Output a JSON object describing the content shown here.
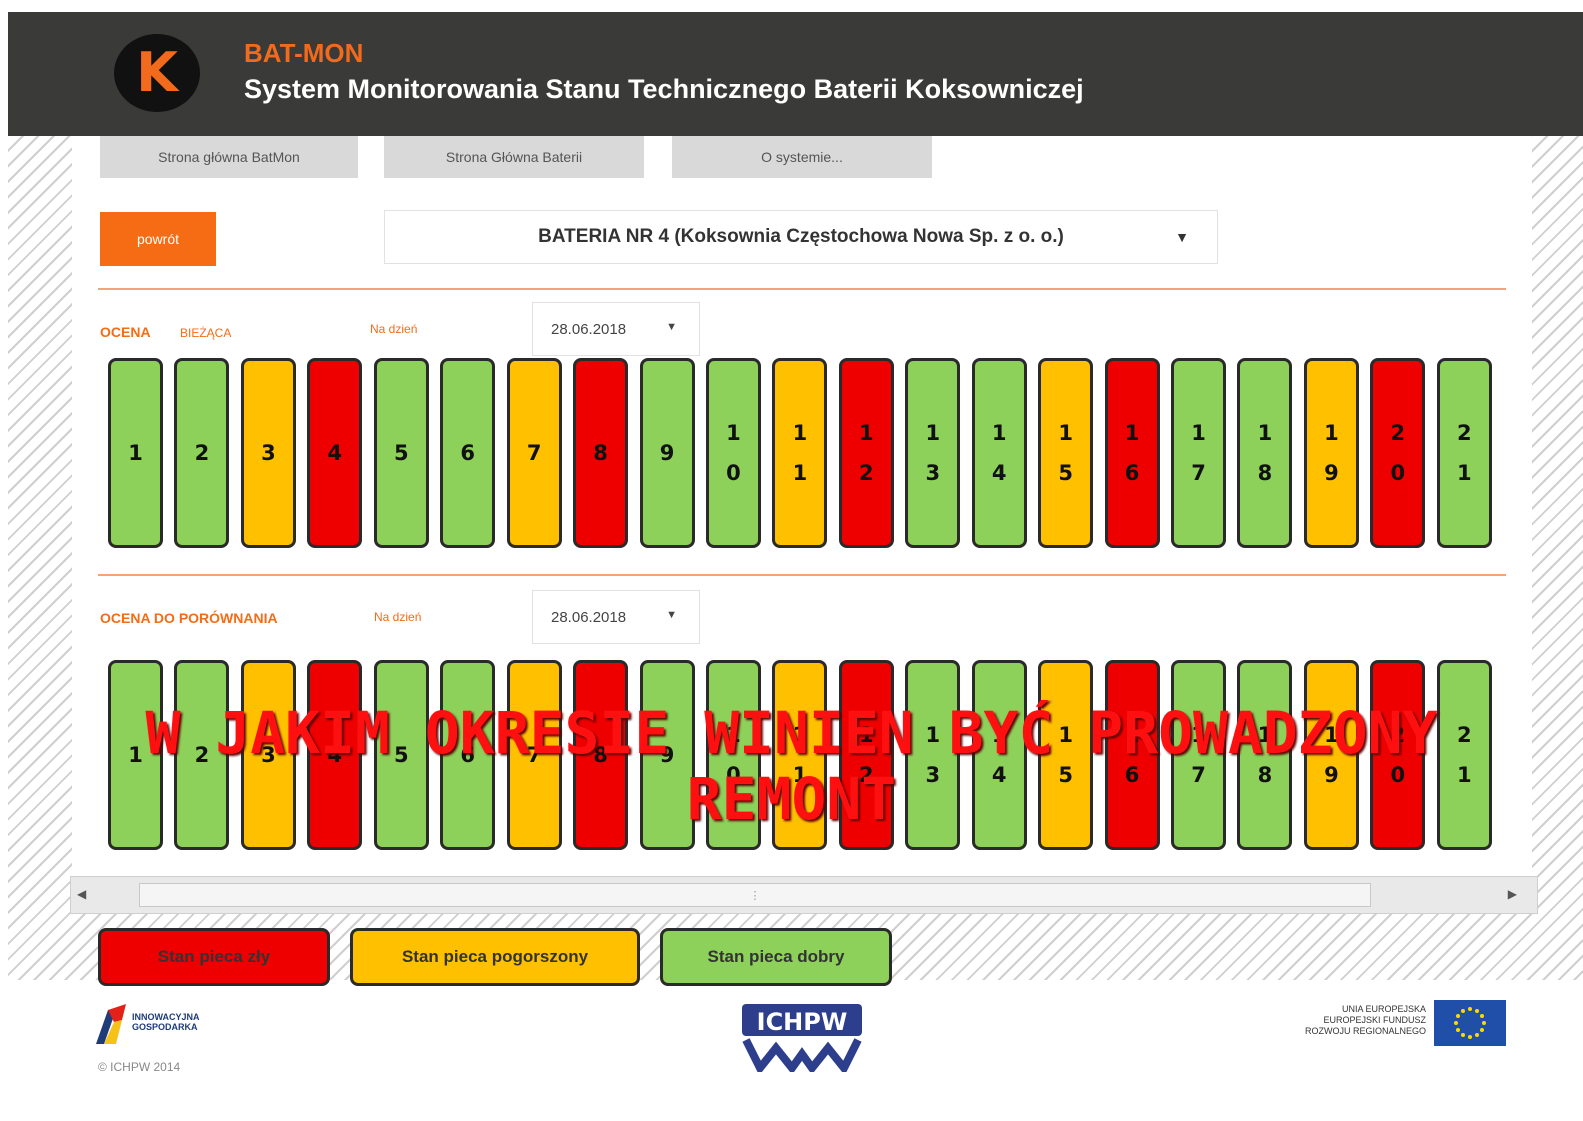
{
  "header": {
    "logo_letter": "K",
    "app_name": "BAT-MON",
    "app_subtitle": "System Monitorowania Stanu Technicznego Baterii Koksowniczej"
  },
  "nav": {
    "home": "Strona główna BatMon",
    "battery_home": "Strona Główna Baterii",
    "about": "O systemie..."
  },
  "back_label": "powrót",
  "battery_select": {
    "value": "BATERIA NR 4 (Koksownia Częstochowa Nowa Sp. z o. o.)"
  },
  "current": {
    "label": "OCENA",
    "sublabel": "BIEŻĄCA",
    "date_label": "Na dzień",
    "date": "28.06.2018"
  },
  "compare": {
    "label": "OCENA DO PORÓWNANIA",
    "date_label": "Na dzień",
    "date": "28.06.2018"
  },
  "ovens_current": [
    {
      "n": "1",
      "s": "good"
    },
    {
      "n": "2",
      "s": "good"
    },
    {
      "n": "3",
      "s": "degraded"
    },
    {
      "n": "4",
      "s": "bad"
    },
    {
      "n": "5",
      "s": "good"
    },
    {
      "n": "6",
      "s": "good"
    },
    {
      "n": "7",
      "s": "degraded"
    },
    {
      "n": "8",
      "s": "bad"
    },
    {
      "n": "9",
      "s": "good"
    },
    {
      "n": "10",
      "s": "good"
    },
    {
      "n": "11",
      "s": "degraded"
    },
    {
      "n": "12",
      "s": "bad"
    },
    {
      "n": "13",
      "s": "good"
    },
    {
      "n": "14",
      "s": "good"
    },
    {
      "n": "15",
      "s": "degraded"
    },
    {
      "n": "16",
      "s": "bad"
    },
    {
      "n": "17",
      "s": "good"
    },
    {
      "n": "18",
      "s": "good"
    },
    {
      "n": "19",
      "s": "degraded"
    },
    {
      "n": "20",
      "s": "bad"
    },
    {
      "n": "21",
      "s": "good"
    }
  ],
  "ovens_compare": [
    {
      "n": "1",
      "s": "good"
    },
    {
      "n": "2",
      "s": "good"
    },
    {
      "n": "3",
      "s": "degraded"
    },
    {
      "n": "4",
      "s": "bad"
    },
    {
      "n": "5",
      "s": "good"
    },
    {
      "n": "6",
      "s": "good"
    },
    {
      "n": "7",
      "s": "degraded"
    },
    {
      "n": "8",
      "s": "bad"
    },
    {
      "n": "9",
      "s": "good"
    },
    {
      "n": "10",
      "s": "good"
    },
    {
      "n": "11",
      "s": "degraded"
    },
    {
      "n": "12",
      "s": "bad"
    },
    {
      "n": "13",
      "s": "good"
    },
    {
      "n": "14",
      "s": "good"
    },
    {
      "n": "15",
      "s": "degraded"
    },
    {
      "n": "16",
      "s": "bad"
    },
    {
      "n": "17",
      "s": "good"
    },
    {
      "n": "18",
      "s": "good"
    },
    {
      "n": "19",
      "s": "degraded"
    },
    {
      "n": "20",
      "s": "bad"
    },
    {
      "n": "21",
      "s": "good"
    }
  ],
  "legend": {
    "bad": "Stan pieca zły",
    "degraded": "Stan pieca pogorszony",
    "good": "Stan pieca dobry"
  },
  "footer": {
    "ig_logo": "INNOWACYJNA GOSPODARKA",
    "copyright": "© ICHPW 2014",
    "ichp_logo": "ICHPW",
    "ue_text": "UNIA EUROPEJSKA EUROPEJSKI FUNDUSZ ROZWOJU REGIONALNEGO"
  },
  "overlay": {
    "line1": "W JAKIM OKRESIE WINIEN BYĆ PROWADZONY",
    "line2": "REMONT"
  },
  "colors": {
    "accent": "#f56c14",
    "good": "#8dd05a",
    "degraded": "#ffc000",
    "bad": "#ee0000",
    "header_bg": "#3a3a38"
  }
}
